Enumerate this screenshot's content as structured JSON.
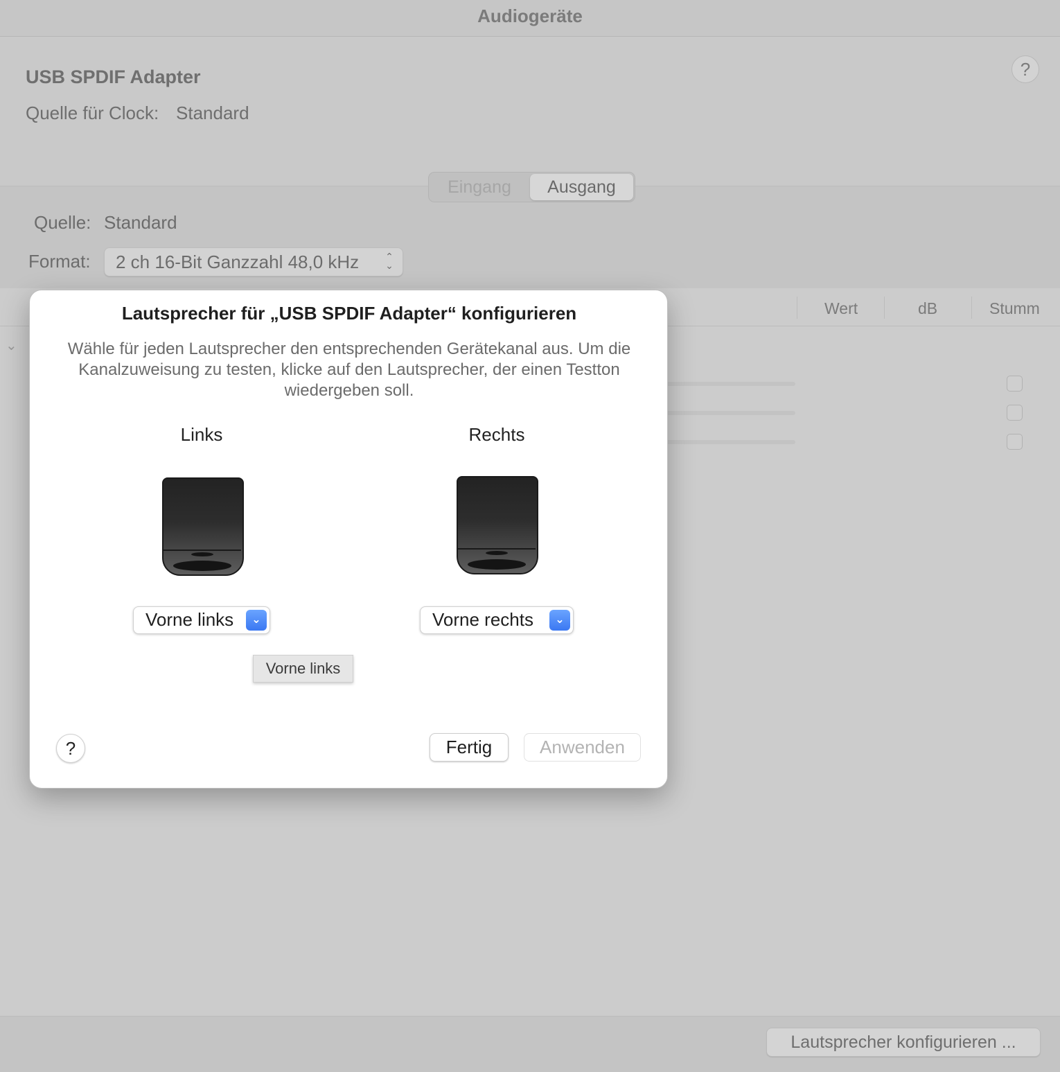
{
  "window": {
    "title": "Audiogeräte"
  },
  "device": {
    "name": "USB SPDIF Adapter",
    "clock_label": "Quelle für Clock:",
    "clock_value": "Standard",
    "help_symbol": "?"
  },
  "tabs": {
    "input_label": "Eingang",
    "output_label": "Ausgang",
    "selected": "Ausgang"
  },
  "output": {
    "source_label": "Quelle:",
    "source_value": "Standard",
    "format_label": "Format:",
    "format_value": "2 ch 16-Bit Ganzzahl 48,0 kHz"
  },
  "table": {
    "columns": [
      "Wert",
      "dB",
      "Stumm"
    ],
    "row_count": 3
  },
  "footer": {
    "configure_button_label": "Lautsprecher konfigurieren ..."
  },
  "sheet": {
    "title": "Lautsprecher für „USB SPDIF Adapter“ konfigurieren",
    "description": "Wähle für jeden Lautsprecher den entsprechenden Gerätekanal aus. Um die Kanalzuweisung zu testen, klicke auf den Lautsprecher, der einen Testton wiedergeben soll.",
    "speakers": [
      {
        "label": "Links",
        "channel": "Vorne links"
      },
      {
        "label": "Rechts",
        "channel": "Vorne rechts"
      }
    ],
    "tooltip": "Vorne links",
    "help_symbol": "?",
    "done_label": "Fertig",
    "apply_label": "Anwenden"
  },
  "colors": {
    "accent": "#3b78f2",
    "background_dimmed": "#cbcbcb",
    "sheet_background": "#ffffff",
    "disabled_text": "#b3b3b3"
  },
  "icons": {
    "help": "question-mark-icon",
    "popup_arrow": "chevron-down-icon",
    "stepper": "up-down-chevrons-icon",
    "speaker": "speaker-icon"
  }
}
